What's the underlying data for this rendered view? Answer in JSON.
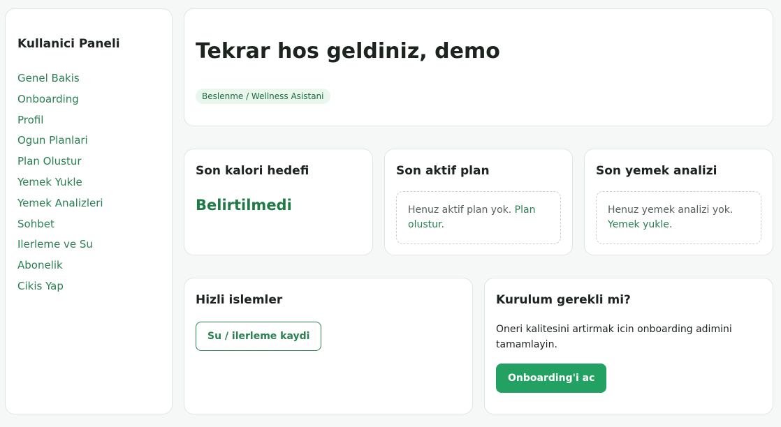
{
  "sidebar": {
    "title": "Kullanici Paneli",
    "items": [
      {
        "label": "Genel Bakis"
      },
      {
        "label": "Onboarding"
      },
      {
        "label": "Profil"
      },
      {
        "label": "Ogun Planlari"
      },
      {
        "label": "Plan Olustur"
      },
      {
        "label": "Yemek Yukle"
      },
      {
        "label": "Yemek Analizleri"
      },
      {
        "label": "Sohbet"
      },
      {
        "label": "Ilerleme ve Su"
      },
      {
        "label": "Abonelik"
      },
      {
        "label": "Cikis Yap"
      }
    ]
  },
  "hero": {
    "title": "Tekrar hos geldiniz, demo",
    "badge": "Beslenme / Wellness Asistani"
  },
  "stats": {
    "calorie": {
      "title": "Son kalori hedefi",
      "value": "Belirtilmedi"
    },
    "plan": {
      "title": "Son aktif plan",
      "empty_text": "Henuz aktif plan yok. ",
      "link": "Plan olustur",
      "suffix": "."
    },
    "analysis": {
      "title": "Son yemek analizi",
      "empty_text": "Henuz yemek analizi yok. ",
      "link": "Yemek yukle",
      "suffix": "."
    }
  },
  "quick_actions": {
    "title": "Hizli islemler",
    "button": "Su / ilerleme kaydi"
  },
  "setup": {
    "title": "Kurulum gerekli mi?",
    "text": "Oneri kalitesini artirmak icin onboarding adimini tamamlayin.",
    "button": "Onboarding'i ac"
  },
  "colors": {
    "accent": "#22a162",
    "link": "#2a8052",
    "badge_bg": "#e8f6ec"
  }
}
